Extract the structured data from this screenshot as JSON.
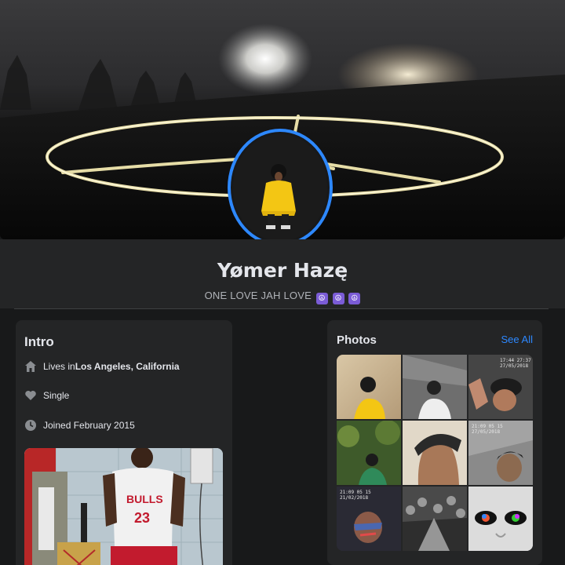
{
  "profile": {
    "name": "Yømer Hazę",
    "bio": "ONE LOVE JAH LOVE",
    "bio_emojis": [
      "☮",
      "☮",
      "☮"
    ]
  },
  "intro": {
    "title": "Intro",
    "lives_prefix": "Lives in ",
    "lives_location": "Los Angeles, California",
    "relationship": "Single",
    "joined": "Joined February 2015"
  },
  "photos": {
    "title": "Photos",
    "see_all": "See All",
    "timestamps": {
      "tile_3": "17:44 27:37\n27/05/2018",
      "tile_7": "21:09 05 15\n21/02/2018",
      "tile_4": "21:09 05 15\n27/05/2018"
    }
  },
  "colors": {
    "accent": "#2d88ff",
    "card": "#242526",
    "background": "#18191a"
  }
}
